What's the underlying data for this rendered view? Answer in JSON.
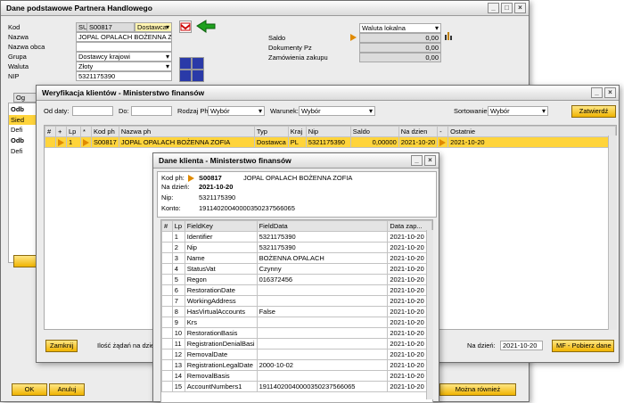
{
  "bp_window": {
    "title": "Dane podstawowe Partnera Handlowego",
    "labels": {
      "kod": "Kod",
      "nazwa": "Nazwa",
      "nazwa_obca": "Nazwa obca",
      "grupa": "Grupa",
      "waluta": "Waluta",
      "nip": "NIP"
    },
    "code_type": "SUP",
    "code": "S00817",
    "partner_type": "Dostawca",
    "name": "JOPAL OPALACH BOŻENNA ZC",
    "group": "Dostawcy krajowi",
    "currency": "Złoty",
    "nip": "5321175390",
    "currency_local": "Waluta lokalna",
    "saldo_label": "Saldo",
    "saldo_value": "0,00",
    "dok_pz_label": "Dokumenty Pz",
    "dok_pz_value": "0,00",
    "zamowienia_label": "Zamówienia zakupu",
    "zamowienia_value": "0,00",
    "side_items": [
      "Odb",
      "Sied",
      "Defi",
      "Odb",
      "Defi"
    ],
    "side_tab": "Og",
    "ok_label": "OK",
    "cancel_label": "Anuluj",
    "mozna_label": "Można również"
  },
  "verify_window": {
    "title": "Weryfikacja klientów - Ministerstwo finansów",
    "filters": {
      "od_daty": "Od daty:",
      "do": "Do:",
      "rodzaj_ph": "Rodzaj Ph:",
      "rodzaj_value": "Wybór",
      "warunek": "Warunek:",
      "warunek_value": "Wybór",
      "sortowanie": "Sortowanie:",
      "sortowanie_value": "Wybór",
      "zatwierdz": "Zatwierdź"
    },
    "columns": [
      "#",
      "+",
      "Lp",
      "*",
      "Kod ph",
      "Nazwa ph",
      "Typ",
      "Kraj",
      "Nip",
      "Saldo",
      "Na dzien",
      "-",
      "Ostatnie"
    ],
    "row": {
      "lp": "1",
      "kod": "S00817",
      "nazwa": "JOPAL OPALACH BOŻENNA ZOFIA",
      "typ": "Dostawca",
      "kraj": "PL",
      "nip": "5321175390",
      "saldo": "0,00000",
      "na_dzien": "2021-10-20",
      "ostatnie": "2021-10-20"
    },
    "zamknij": "Zamknij",
    "ilosc_label": "Ilość żądań na dzien",
    "na_dzien_label": "Na dzień:",
    "na_dzien_value": "2021-10-20",
    "pobierz": "MF - Pobierz dane"
  },
  "client_window": {
    "title": "Dane klienta - Ministerstwo finansów",
    "kod_ph_label": "Kod ph:",
    "kod_ph": "S00817",
    "kod_name": "JOPAL OPALACH BOŻENNA ZOFIA",
    "na_dzien_label": "Na dzień:",
    "na_dzien": "2021-10-20",
    "nip_label": "Nip:",
    "nip": "5321175390",
    "konto_label": "Konto:",
    "konto": "19114020040000350237566065",
    "columns": [
      "#",
      "Lp",
      "FieldKey",
      "FieldData",
      "Data zap..."
    ],
    "rows": [
      {
        "lp": "1",
        "key": "Identifier",
        "data": "5321175390",
        "date": "2021-10-20 0"
      },
      {
        "lp": "2",
        "key": "Nip",
        "data": "5321175390",
        "date": "2021-10-20 0"
      },
      {
        "lp": "3",
        "key": "Name",
        "data": "BOŻENNA OPALACH",
        "date": "2021-10-20 0"
      },
      {
        "lp": "4",
        "key": "StatusVat",
        "data": "Czynny",
        "date": "2021-10-20 0"
      },
      {
        "lp": "5",
        "key": "Regon",
        "data": "016372456",
        "date": "2021-10-20 0"
      },
      {
        "lp": "6",
        "key": "RestorationDate",
        "data": "",
        "date": "2021-10-20 0"
      },
      {
        "lp": "7",
        "key": "WorkingAddress",
        "data": "",
        "date": "2021-10-20 0"
      },
      {
        "lp": "8",
        "key": "HasVirtualAccounts",
        "data": "False",
        "date": "2021-10-20 0"
      },
      {
        "lp": "9",
        "key": "Krs",
        "data": "",
        "date": "2021-10-20 0"
      },
      {
        "lp": "10",
        "key": "RestorationBasis",
        "data": "",
        "date": "2021-10-20 0"
      },
      {
        "lp": "11",
        "key": "RegistrationDenialBasi",
        "data": "",
        "date": "2021-10-20 0"
      },
      {
        "lp": "12",
        "key": "RemovalDate",
        "data": "",
        "date": "2021-10-20 0"
      },
      {
        "lp": "13",
        "key": "RegistrationLegalDate",
        "data": "2000-10-02",
        "date": "2021-10-20 0"
      },
      {
        "lp": "14",
        "key": "RemovalBasis",
        "data": "",
        "date": "2021-10-20 0"
      },
      {
        "lp": "15",
        "key": "AccountNumbers1",
        "data": "19114020040000350237566065",
        "date": "2021-10-20 0"
      }
    ]
  },
  "colors": {
    "accent": "#f0b400",
    "selected_row": "#ffd43b",
    "arrow": "#e08a00"
  }
}
